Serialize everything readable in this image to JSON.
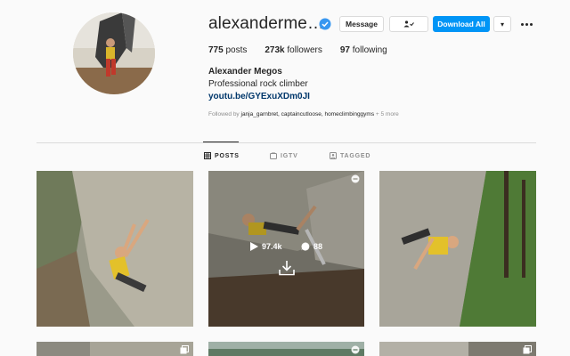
{
  "profile": {
    "username": "alexanderme…",
    "verified": true,
    "buttons": {
      "message": "Message",
      "follow": "👤✓",
      "download_all": "Download All",
      "dropdown": "▾"
    },
    "stats": {
      "posts_count": "775",
      "posts_label": "posts",
      "followers_count": "273k",
      "followers_label": "followers",
      "following_count": "97",
      "following_label": "following"
    },
    "full_name": "Alexander Megos",
    "bio": "Professional rock climber",
    "link": "youtu.be/GYExuXDm0JI",
    "followed_by_prefix": "Followed by",
    "followed_by_names": "janja_garnbret, captaincutloose, homeclimbinggyms",
    "followed_by_more": "+ 5 more"
  },
  "tabs": [
    {
      "label": "POSTS",
      "icon": "grid-icon",
      "active": true
    },
    {
      "label": "IGTV",
      "icon": "igtv-icon",
      "active": false
    },
    {
      "label": "TAGGED",
      "icon": "tag-icon",
      "active": false
    }
  ],
  "posts": [
    {
      "type": "image"
    },
    {
      "type": "video",
      "views": "97.4k",
      "comments": "88",
      "icon": "video-indicator-icon"
    },
    {
      "type": "image"
    },
    {
      "type": "carousel",
      "icon": "carousel-icon"
    },
    {
      "type": "video",
      "icon": "video-indicator-icon"
    },
    {
      "type": "carousel",
      "icon": "carousel-icon"
    }
  ],
  "colors": {
    "accent": "#0095f6",
    "link": "#00376b",
    "muted": "#8e8e8e",
    "text": "#262626",
    "background": "#fafafa"
  }
}
